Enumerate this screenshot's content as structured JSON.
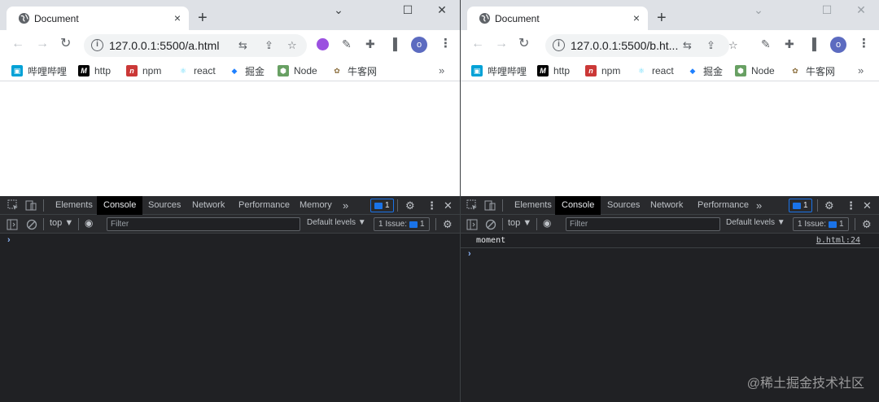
{
  "windows": [
    {
      "tab": {
        "title": "Document",
        "close": "×"
      },
      "new_tab": "+",
      "controls": {
        "minimize": "⌄",
        "maximize": "☐",
        "close": "✕"
      },
      "url": "127.0.0.1:5500/a.html",
      "avatar": "o",
      "bookmarks": [
        "哔哩哔哩",
        "http",
        "npm",
        "react",
        "掘金",
        "Node",
        "牛客网"
      ],
      "bookmarks_more": "»",
      "devtools": {
        "tabs": [
          "Elements",
          "Console",
          "Sources",
          "Network",
          "Performance",
          "Memory"
        ],
        "active_tab": "Console",
        "more": "»",
        "message_count": "1",
        "context": "top ▼",
        "filter_placeholder": "Filter",
        "levels": "Default levels ▼",
        "issues_label": "1 Issue:",
        "issues_count": "1",
        "prompt": "›"
      }
    },
    {
      "tab": {
        "title": "Document",
        "close": "×"
      },
      "new_tab": "+",
      "controls": {
        "minimize": "⌄",
        "maximize": "☐",
        "close": "✕"
      },
      "url": "127.0.0.1:5500/b.ht...",
      "avatar": "o",
      "bookmarks": [
        "哔哩哔哩",
        "http",
        "npm",
        "react",
        "掘金",
        "Node",
        "牛客网"
      ],
      "bookmarks_more": "»",
      "devtools": {
        "tabs": [
          "Elements",
          "Console",
          "Sources",
          "Network",
          "Performance"
        ],
        "active_tab": "Console",
        "more": "»",
        "message_count": "1",
        "context": "top ▼",
        "filter_placeholder": "Filter",
        "levels": "Default levels ▼",
        "issues_label": "1 Issue:",
        "issues_count": "1",
        "log": {
          "message": "moment",
          "source": "b.html:24"
        },
        "prompt": "›"
      }
    }
  ],
  "watermark": "@稀土掘金技术社区",
  "colors": {
    "bilibili": "#00a1d6",
    "npm": "#cb3837",
    "react": "#61dafb",
    "juejin": "#1e80ff",
    "node": "#68a063",
    "accent": "#1a73e8"
  }
}
